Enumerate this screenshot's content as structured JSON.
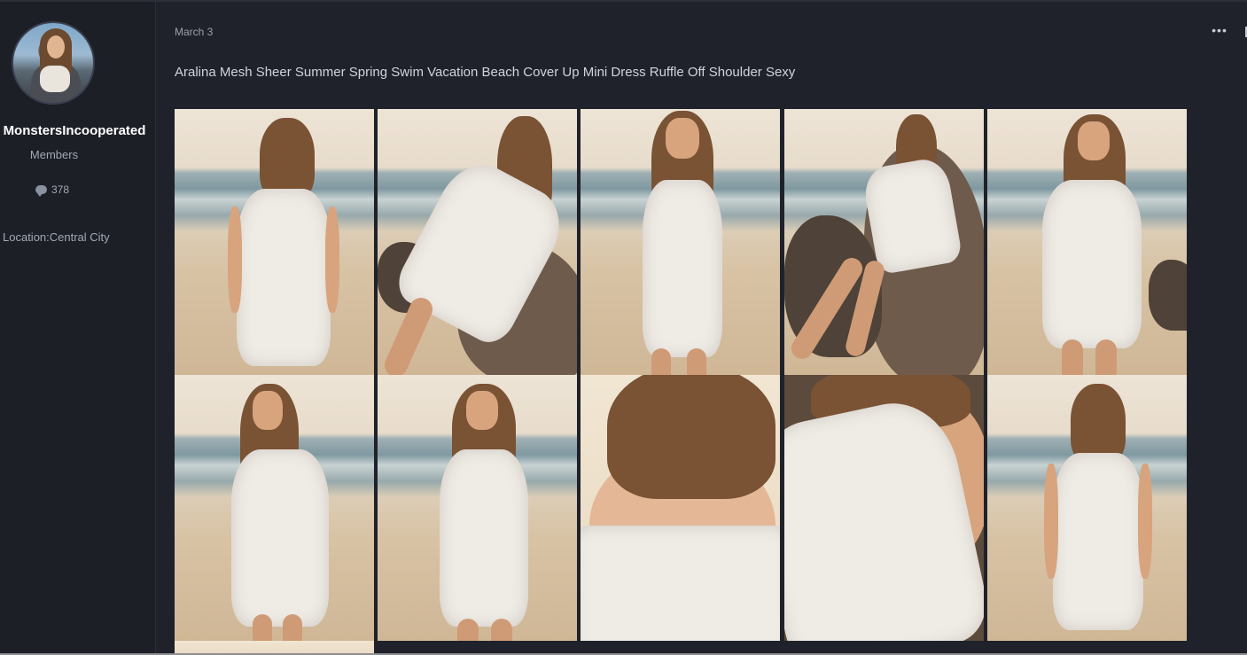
{
  "author": {
    "username": "MonstersIncooperated",
    "group": "Members",
    "post_count": "378",
    "location": "Location:Central City",
    "avatar_icon": "avatar-photo"
  },
  "post": {
    "date": "March 3",
    "menu_icon": "ellipsis-icon",
    "menu_label": "•••",
    "title": "Aralina Mesh Sheer Summer Spring Swim Vacation Beach Cover Up Mini Dress Ruffle Off Shoulder Sexy"
  },
  "gallery": {
    "images": [
      "photo-back-view-beach",
      "photo-leaning-rock-side",
      "photo-front-shoulder-tie",
      "photo-sitting-rock-legs",
      "photo-front-off-shoulder",
      "photo-off-shoulder-turned",
      "photo-front-walking",
      "photo-closeup-neck-tie",
      "photo-closeup-off-shoulder",
      "photo-back-view-beach-2",
      "photo-partial-bottom"
    ]
  },
  "colors": {
    "background": "#1f222a",
    "sidebar": "#1c1f26",
    "text_primary": "#ffffff",
    "text_muted": "#a2a9b5"
  }
}
